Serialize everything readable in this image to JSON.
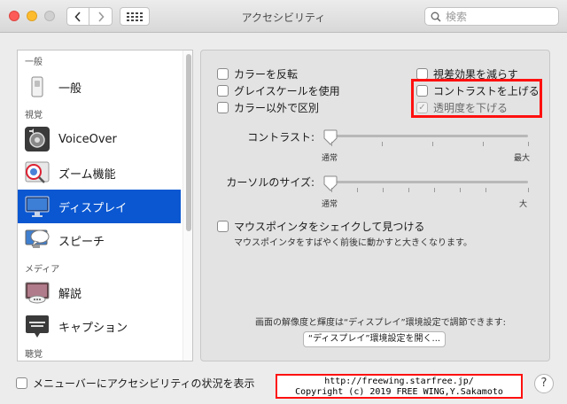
{
  "window": {
    "title": "アクセシビリティ",
    "search_placeholder": "検索"
  },
  "sidebar": {
    "sections": [
      "一般",
      "視覚",
      "メディア",
      "聴覚"
    ],
    "items": [
      {
        "label": "一般",
        "icon": "switch-icon"
      },
      {
        "label": "VoiceOver",
        "icon": "voiceover-icon"
      },
      {
        "label": "ズーム機能",
        "icon": "zoom-icon"
      },
      {
        "label": "ディスプレイ",
        "icon": "display-icon",
        "selected": true
      },
      {
        "label": "スピーチ",
        "icon": "speech-icon"
      },
      {
        "label": "解説",
        "icon": "descriptions-icon"
      },
      {
        "label": "キャプション",
        "icon": "captions-icon"
      }
    ]
  },
  "panel": {
    "checkboxes_left": [
      "カラーを反転",
      "グレイスケールを使用",
      "カラー以外で区別"
    ],
    "checkboxes_right": [
      {
        "label": "視差効果を減らす",
        "checked": false,
        "disabled": false
      },
      {
        "label": "コントラストを上げる",
        "checked": false,
        "disabled": false
      },
      {
        "label": "透明度を下げる",
        "checked": true,
        "disabled": true
      }
    ],
    "contrast": {
      "label": "コントラスト:",
      "min": "通常",
      "max": "最大",
      "value": 0
    },
    "cursor": {
      "label": "カーソルのサイズ:",
      "min": "通常",
      "max": "大",
      "value": 0
    },
    "shake": {
      "label": "マウスポインタをシェイクして見つける",
      "description": "マウスポインタをすばやく前後に動かすと大きくなります。"
    },
    "display_note": "画面の解像度と輝度は“ディスプレイ”環境設定で調節できます:",
    "display_button": "“ディスプレイ”環境設定を開く..."
  },
  "footer": {
    "menubar_checkbox": "メニューバーにアクセシビリティの状況を表示",
    "credit_line1": "http://freewing.starfree.jp/",
    "credit_line2": "Copyright (c) 2019 FREE WING,Y.Sakamoto",
    "help": "?"
  }
}
